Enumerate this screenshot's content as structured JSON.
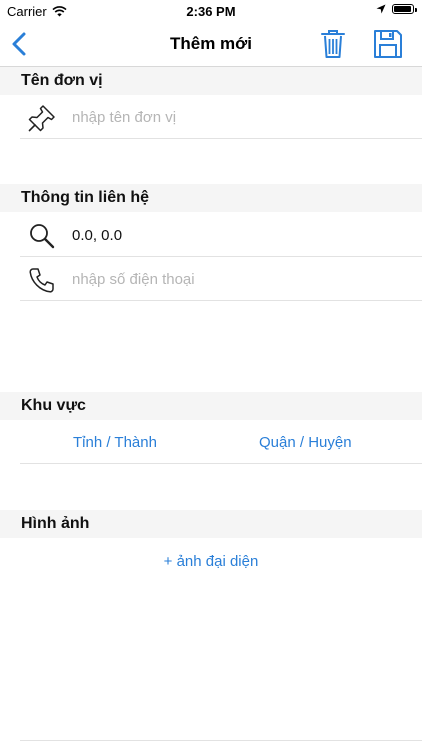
{
  "status_bar": {
    "carrier": "Carrier",
    "time": "2:36 PM",
    "battery_level": 0.95
  },
  "nav": {
    "title": "Thêm mới"
  },
  "sections": {
    "unit": {
      "title": "Tên đơn vị",
      "name_placeholder": "nhập tên đơn vị"
    },
    "contact": {
      "title": "Thông tin liên hệ",
      "coordinates": "0.0, 0.0",
      "phone_placeholder": "nhập số điện thoại"
    },
    "region": {
      "title": "Khu vực",
      "province_label": "Tỉnh / Thành",
      "district_label": "Quận / Huyện"
    },
    "images": {
      "title": "Hình ảnh",
      "add_avatar_label": "+ ảnh đại diện"
    }
  },
  "colors": {
    "accent": "#2a7fd8",
    "section_bg": "#f5f5f5",
    "placeholder": "#b5b5b5"
  }
}
